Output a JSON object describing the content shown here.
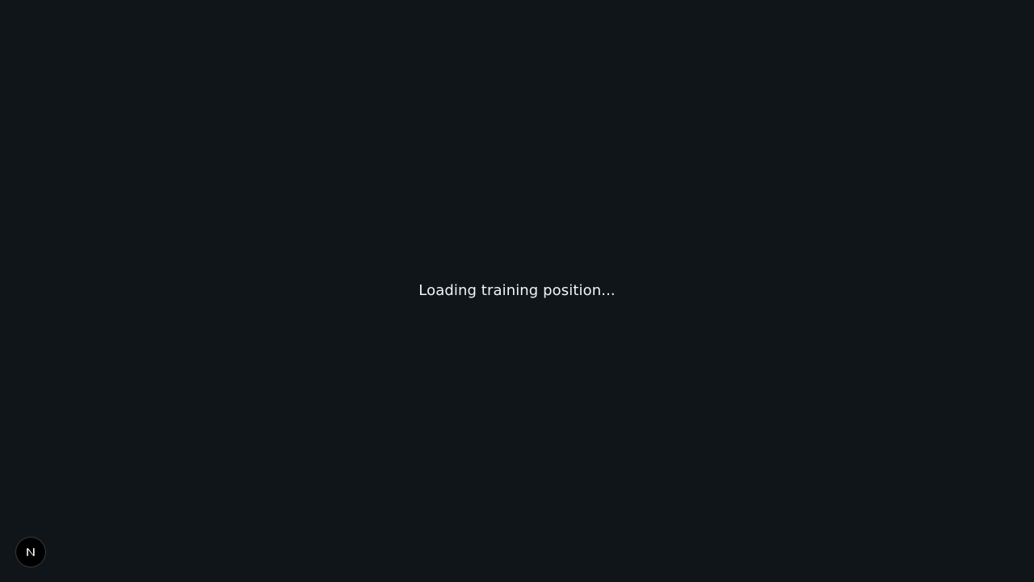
{
  "page": {
    "background_color": "#10151a",
    "loading_text": "Loading training position..."
  },
  "dev_indicator": {
    "icon": "nextjs-logo-icon",
    "color": "#ffffff",
    "background": "#000000"
  }
}
